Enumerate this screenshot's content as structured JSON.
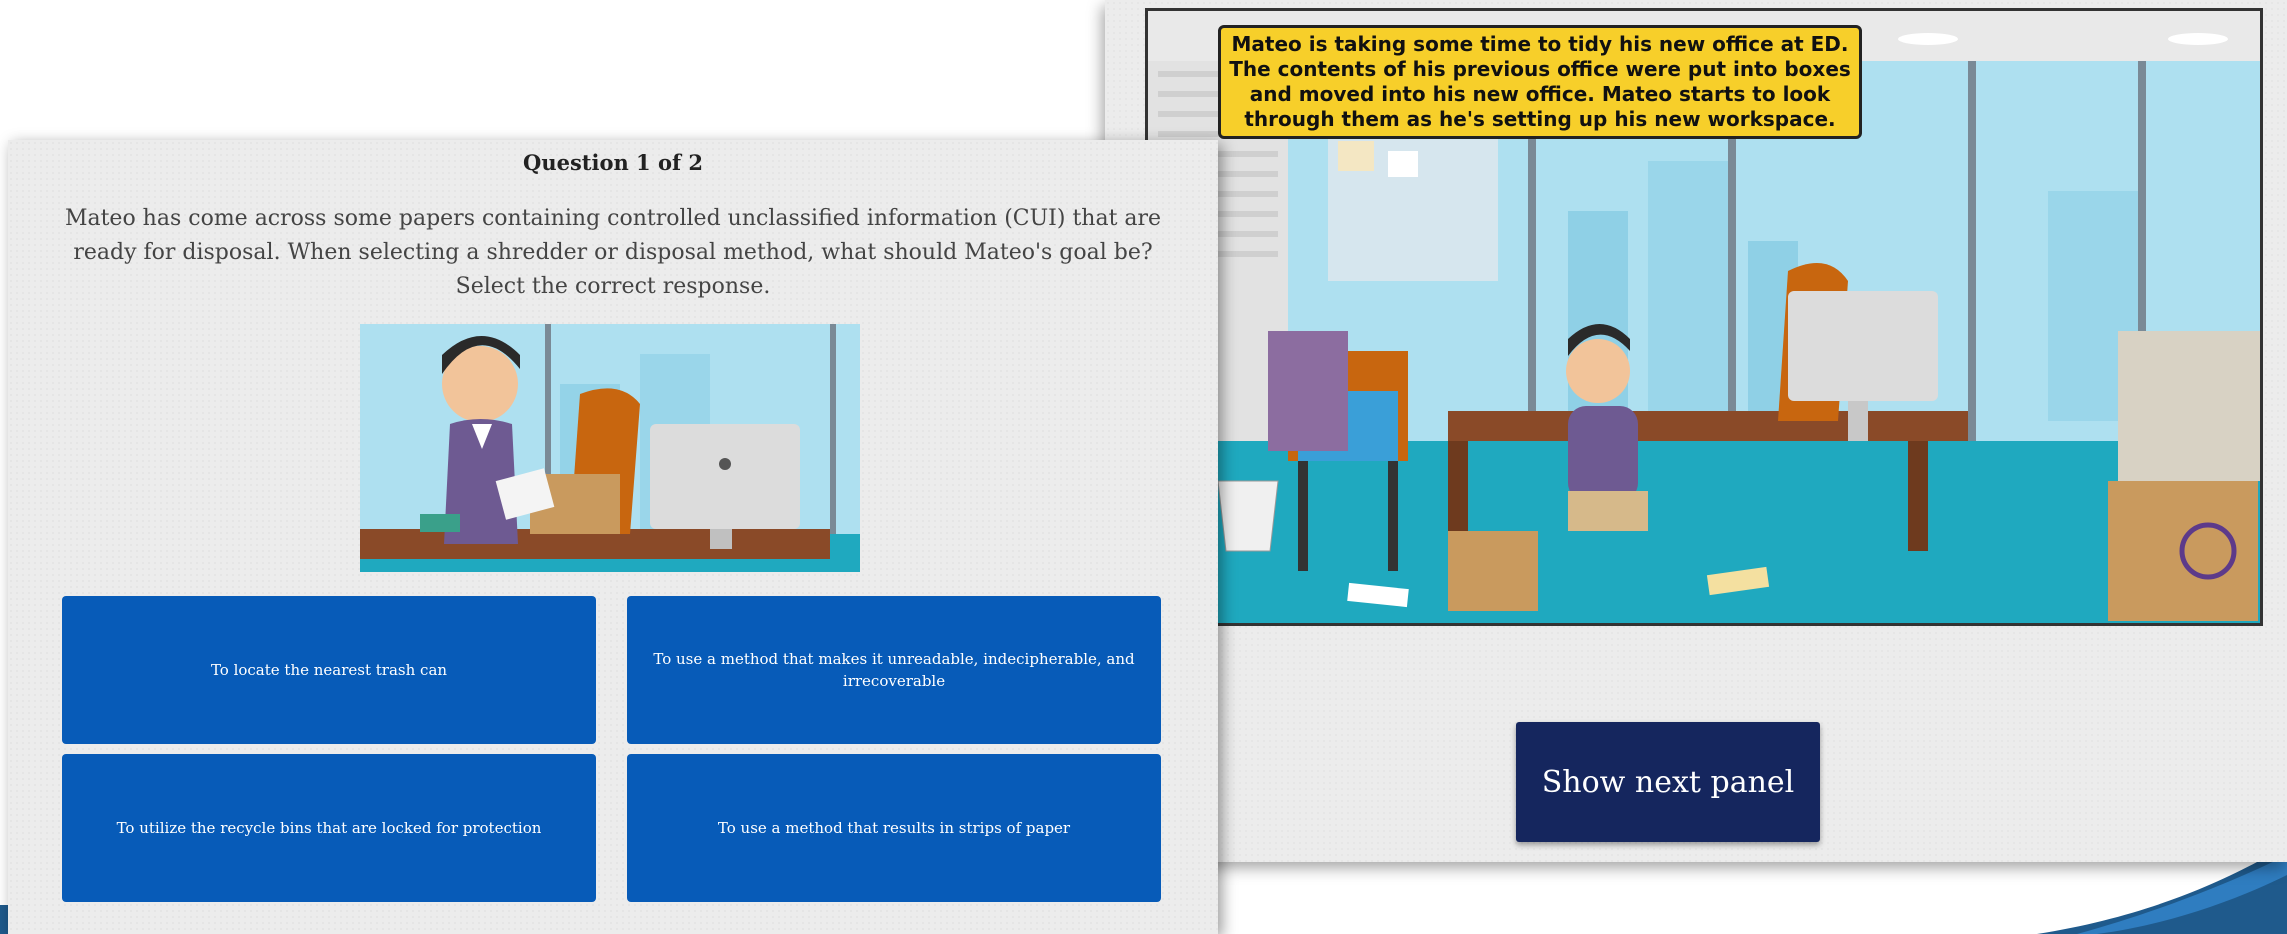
{
  "comic_panel": {
    "caption": "Mateo is taking some time to tidy his new office at ED. The contents of his previous office were put into boxes and moved into his new office. Mateo starts to look through them as he's setting up his new workspace.",
    "next_button_label": "Show next panel"
  },
  "quiz": {
    "counter": "Question 1 of 2",
    "question": "Mateo has come across some papers containing controlled unclassified information (CUI) that are ready for disposal. When selecting a shredder or disposal method, what should Mateo's goal be?",
    "instruction": "Select the correct response.",
    "answers": [
      {
        "label": "To locate the nearest trash can"
      },
      {
        "label": "To use a method that makes it unreadable, indecipherable, and irrecoverable"
      },
      {
        "label": "To utilize the recycle bins that are locked for protection"
      },
      {
        "label": "To use a method that results in strips of paper"
      }
    ]
  },
  "colors": {
    "answer_button": "#075bb8",
    "next_button": "#15265e",
    "caption_bg": "#f7cf2a",
    "corner_accent": "#1f5a8c"
  }
}
